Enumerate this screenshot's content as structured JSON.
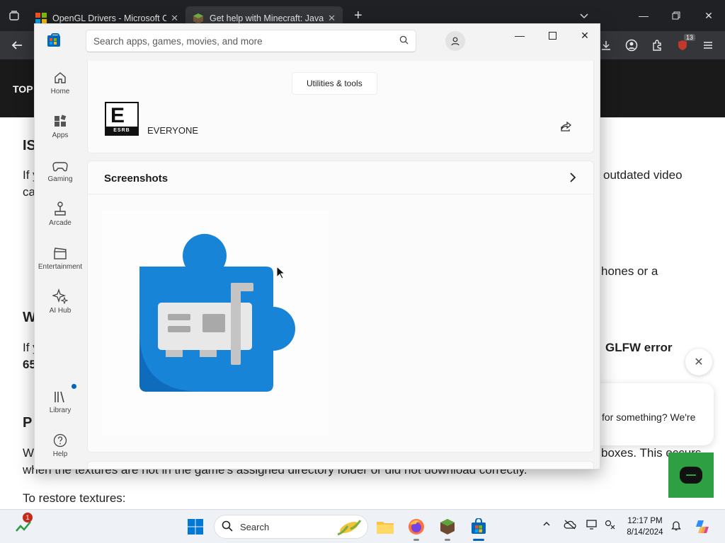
{
  "browser": {
    "tabs": [
      {
        "title": "OpenGL Drivers - Microsoft Cor"
      },
      {
        "title": "Get help with Minecraft: Java E"
      }
    ],
    "extension_badge": "13"
  },
  "website": {
    "nav_label": "TOP",
    "fragments": {
      "h1": "IS",
      "p1a": "If y",
      "p1b": "outdated video",
      "p1c": "ca",
      "p2": "hones or a",
      "h2": "W",
      "p3a": "If y",
      "p3b": "GLFW error",
      "p3c": "65",
      "h3": "P",
      "p4a": "W",
      "p4b": "boxes. This occurs",
      "p4c": "when the textures are not in the game's assigned directory folder or did not download correctly.",
      "p5": "To restore textures:"
    },
    "chat": {
      "message": "for something? We're"
    }
  },
  "store": {
    "search_placeholder": "Search apps, games, movies, and more",
    "nav": [
      {
        "label": "Home"
      },
      {
        "label": "Apps"
      },
      {
        "label": "Gaming"
      },
      {
        "label": "Arcade"
      },
      {
        "label": "Entertainment"
      },
      {
        "label": "AI Hub"
      },
      {
        "label": "Library"
      },
      {
        "label": "Help"
      }
    ],
    "category_chip": "Utilities & tools",
    "rating": {
      "label": "EVERYONE",
      "esrb_letter": "E",
      "esrb_text": "ESRB"
    },
    "screenshots_title": "Screenshots"
  },
  "taskbar": {
    "search_label": "Search",
    "notification_count": "1",
    "time": "12:17 PM",
    "date": "8/14/2024"
  },
  "colors": {
    "store_accent": "#0067c0",
    "puzzle_blue": "#1784d8",
    "chat_green": "#2ea043"
  }
}
